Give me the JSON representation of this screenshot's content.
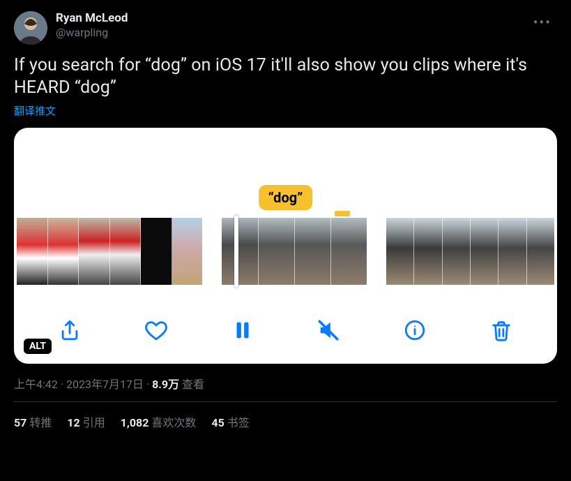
{
  "author": {
    "display_name": "Ryan McLeod",
    "handle": "@warpling"
  },
  "tweet_text": "If you search for “dog” on iOS 17 it'll also show you clips where it's HEARD “dog”",
  "translate_label": "翻译推文",
  "media": {
    "search_term_chip": "“dog”",
    "alt_badge": "ALT"
  },
  "meta": {
    "time": "上午4:42",
    "dot1": " · ",
    "date": "2023年7月17日",
    "dot2": " · ",
    "views_number": "8.9万",
    "views_label": " 查看"
  },
  "stats": {
    "retweets_count": "57",
    "retweets_label": "转推",
    "quotes_count": "12",
    "quotes_label": "引用",
    "likes_count": "1,082",
    "likes_label": "喜欢次数",
    "bookmarks_count": "45",
    "bookmarks_label": "书签"
  }
}
